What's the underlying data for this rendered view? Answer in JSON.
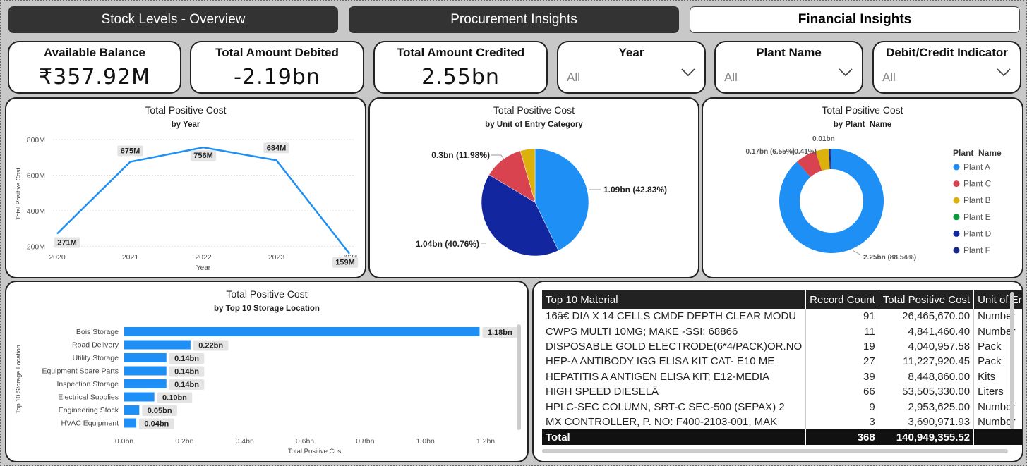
{
  "tabs": [
    {
      "label": "Stock Levels - Overview",
      "active": false
    },
    {
      "label": "Procurement Insights",
      "active": false
    },
    {
      "label": "Financial Insights",
      "active": true
    }
  ],
  "kpis": {
    "available_balance": {
      "title": "Available Balance",
      "value": "₹357.92M"
    },
    "total_debited": {
      "title": "Total Amount Debited",
      "value": "-2.19bn"
    },
    "total_credited": {
      "title": "Total Amount Credited",
      "value": "2.55bn"
    }
  },
  "slicers": {
    "year": {
      "title": "Year",
      "value": "All"
    },
    "plant_name": {
      "title": "Plant Name",
      "value": "All"
    },
    "debit_credit": {
      "title": "Debit/Credit Indicator",
      "value": "All"
    }
  },
  "colors": {
    "blue": "#1e90f5",
    "red": "#d9434f",
    "yellow": "#dcb10c",
    "green": "#0b9a3c",
    "navy": "#1226a0",
    "darknavy": "#15268a"
  },
  "chart_data": [
    {
      "id": "by_year",
      "type": "line",
      "title": "Total Positive Cost",
      "subtitle": "by Year",
      "xlabel": "Year",
      "ylabel": "Total Positive Cost",
      "x": [
        "2020",
        "2021",
        "2022",
        "2023",
        "2024"
      ],
      "values": [
        271,
        675,
        756,
        684,
        159
      ],
      "data_labels": [
        "271M",
        "675M",
        "756M",
        "684M",
        "159M"
      ],
      "yticks": [
        "200M",
        "400M",
        "600M",
        "800M"
      ],
      "ylim": [
        150,
        800
      ],
      "grid": true
    },
    {
      "id": "by_unit",
      "type": "pie",
      "title": "Total Positive Cost",
      "subtitle": "by Unit of Entry Category",
      "slices": [
        {
          "value": 1.09,
          "label": "1.09bn (42.83%)",
          "pct": 42.83,
          "color": "#1e90f5"
        },
        {
          "value": 1.04,
          "label": "1.04bn (40.76%)",
          "pct": 40.76,
          "color": "#1226a0"
        },
        {
          "value": 0.3,
          "label": "0.3bn (11.98%)",
          "pct": 11.98,
          "color": "#d9434f"
        },
        {
          "value": 0.11,
          "label": "",
          "pct": 4.43,
          "color": "#dcb10c"
        }
      ]
    },
    {
      "id": "by_plant",
      "type": "pie",
      "title": "Total Positive Cost",
      "subtitle": "by Plant_Name",
      "legend_title": "Plant_Name",
      "legend_position": "right",
      "slices": [
        {
          "name": "Plant A",
          "pct": 88.54,
          "label": "2.25bn (88.54%)",
          "color": "#1e90f5"
        },
        {
          "name": "Plant C",
          "pct": 6.55,
          "label": "0.17bn (6.55%)",
          "color": "#d9434f"
        },
        {
          "name": "Plant B",
          "pct": 4.0,
          "label": "",
          "color": "#dcb10c"
        },
        {
          "name": "Plant E",
          "pct": 0.1,
          "label": "",
          "color": "#0b9a3c"
        },
        {
          "name": "Plant D",
          "pct": 0.41,
          "label": "0.01bn (0.41%)",
          "color": "#1226a0"
        },
        {
          "name": "Plant F",
          "pct": 0.4,
          "label": "",
          "color": "#15268a"
        }
      ]
    },
    {
      "id": "by_storage",
      "type": "bar",
      "title": "Total Positive Cost",
      "subtitle": "by Top 10 Storage Location",
      "xlabel": "Total Positive Cost",
      "ylabel": "Top 10 Storage Location",
      "categories": [
        "Bois Storage",
        "Road Delivery",
        "Utility Storage",
        "Equipment Spare Parts",
        "Inspection Storage",
        "Electrical Supplies",
        "Engineering Stock",
        "HVAC Equipment"
      ],
      "values": [
        1.18,
        0.22,
        0.14,
        0.14,
        0.14,
        0.1,
        0.05,
        0.04
      ],
      "data_labels": [
        "1.18bn",
        "0.22bn",
        "0.14bn",
        "0.14bn",
        "0.14bn",
        "0.10bn",
        "0.05bn",
        "0.04bn"
      ],
      "xticks": [
        "0.0bn",
        "0.2bn",
        "0.4bn",
        "0.6bn",
        "0.8bn",
        "1.0bn",
        "1.2bn"
      ],
      "xlim": [
        0,
        1.2
      ]
    }
  ],
  "table": {
    "columns": [
      "Top 10 Material",
      "Record Count",
      "Total Positive Cost",
      "Unit of Entry"
    ],
    "rows": [
      [
        "16â€ DIA X 14 CELLS CMDF DEPTH CLEAR MODU",
        "91",
        "26,465,670.00",
        "Number"
      ],
      [
        "CWPS MULTI 10MG; MAKE -SSI; 68866",
        "11",
        "4,841,460.40",
        "Number"
      ],
      [
        "DISPOSABLE GOLD ELECTRODE(6*4/PACK)OR.NO",
        "19",
        "4,040,957.58",
        "Pack"
      ],
      [
        "HEP-A ANTIBODY IGG ELISA KIT CAT- E10 ME",
        "27",
        "11,227,920.45",
        "Pack"
      ],
      [
        "HEPATITIS A ANTIGEN ELISA KIT; E12-MEDIA",
        "39",
        "8,448,860.00",
        "Kits"
      ],
      [
        "HIGH SPEED DIESELÂ",
        "66",
        "53,505,330.00",
        "Liters"
      ],
      [
        "HPLC-SEC COLUMN, SRT-C SEC-500 (SEPAX) 2",
        "9",
        "2,953,625.00",
        "Number"
      ],
      [
        "MX CONTROLLER, P. NO: F400-2103-001, MAK",
        "3",
        "3,690,971.93",
        "Number"
      ]
    ],
    "total": [
      "Total",
      "368",
      "140,949,355.52",
      ""
    ]
  }
}
